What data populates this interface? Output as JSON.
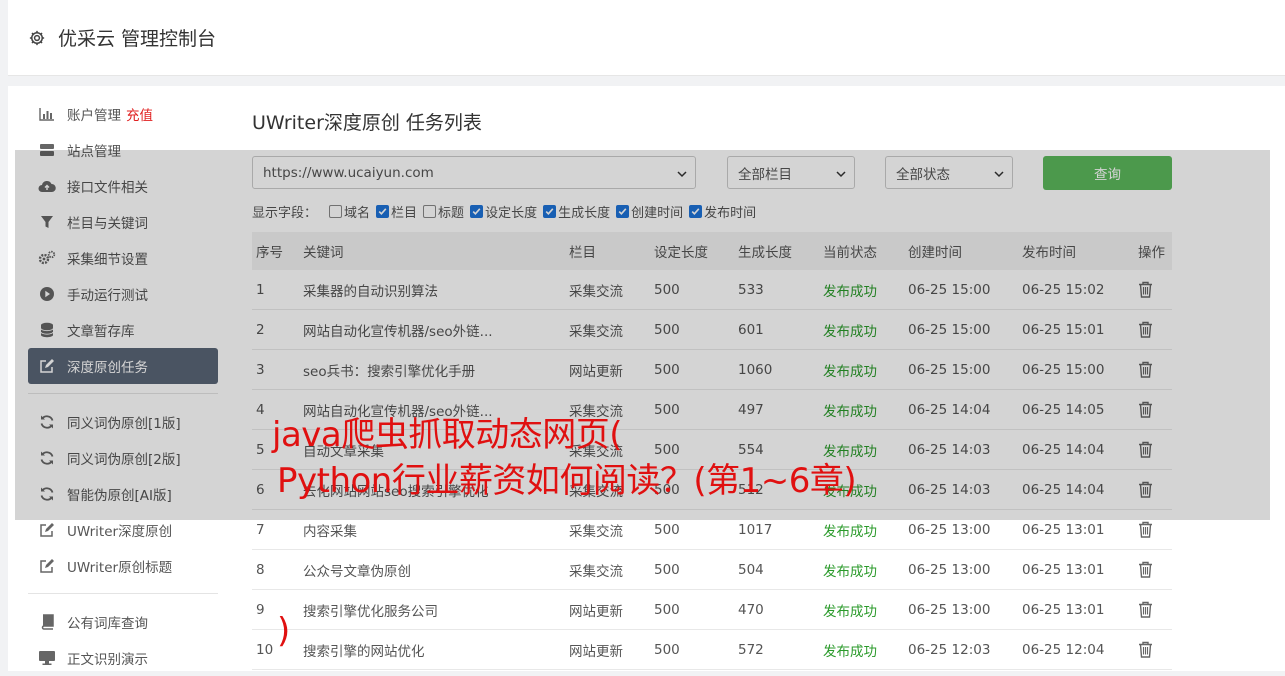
{
  "header": {
    "title": "优采云 管理控制台",
    "icon": "gear-icon"
  },
  "sidebar": {
    "group1": [
      {
        "label": "账户管理",
        "badge": "充值",
        "icon": "bar-chart-icon"
      },
      {
        "label": "站点管理",
        "icon": "server-icon"
      },
      {
        "label": "接口文件相关",
        "icon": "cloud-upload-icon"
      },
      {
        "label": "栏目与关键词",
        "icon": "filter-icon"
      },
      {
        "label": "采集细节设置",
        "icon": "cogs-icon"
      },
      {
        "label": "手动运行测试",
        "icon": "play-circle-icon"
      },
      {
        "label": "文章暂存库",
        "icon": "database-icon"
      },
      {
        "label": "深度原创任务",
        "icon": "edit-icon",
        "active": true
      }
    ],
    "group2": [
      {
        "label": "同义词伪原创[1版]",
        "icon": "refresh-icon"
      },
      {
        "label": "同义词伪原创[2版]",
        "icon": "refresh-icon"
      },
      {
        "label": "智能伪原创[AI版]",
        "icon": "refresh-icon"
      },
      {
        "label": "UWriter深度原创",
        "icon": "edit-icon"
      },
      {
        "label": "UWriter原创标题",
        "icon": "edit-icon"
      }
    ],
    "group3": [
      {
        "label": "公有词库查询",
        "icon": "book-icon"
      },
      {
        "label": "正文识别演示",
        "icon": "desktop-icon"
      }
    ]
  },
  "main": {
    "title": "UWriter深度原创 任务列表",
    "site_select": "https://www.ucaiyun.com",
    "column_select": "全部栏目",
    "status_select": "全部状态",
    "query_label": "查询",
    "fields_label": "显示字段：",
    "fields": [
      {
        "label": "域名",
        "checked": false
      },
      {
        "label": "栏目",
        "checked": true
      },
      {
        "label": "标题",
        "checked": false
      },
      {
        "label": "设定长度",
        "checked": true
      },
      {
        "label": "生成长度",
        "checked": true
      },
      {
        "label": "创建时间",
        "checked": true
      },
      {
        "label": "发布时间",
        "checked": true
      }
    ],
    "columns": [
      "序号",
      "关键词",
      "栏目",
      "设定长度",
      "生成长度",
      "当前状态",
      "创建时间",
      "发布时间",
      "操作"
    ],
    "rows": [
      [
        "1",
        "采集器的自动识别算法",
        "采集交流",
        "500",
        "533",
        "发布成功",
        "06-25 15:00",
        "06-25 15:02"
      ],
      [
        "2",
        "网站自动化宣传机器/seo外链...",
        "采集交流",
        "500",
        "601",
        "发布成功",
        "06-25 15:00",
        "06-25 15:01"
      ],
      [
        "3",
        "seo兵书：搜索引擎优化手册",
        "网站更新",
        "500",
        "1060",
        "发布成功",
        "06-25 15:00",
        "06-25 15:00"
      ],
      [
        "4",
        "网站自动化宣传机器/seo外链...",
        "采集交流",
        "500",
        "497",
        "发布成功",
        "06-25 14:04",
        "06-25 14:05"
      ],
      [
        "5",
        "自动文章采集",
        "采集交流",
        "500",
        "554",
        "发布成功",
        "06-25 14:03",
        "06-25 14:04"
      ],
      [
        "6",
        "去化网站网站seo搜索引擎优化",
        "采集交流",
        "500",
        "512",
        "发布成功",
        "06-25 14:03",
        "06-25 14:04"
      ],
      [
        "7",
        "内容采集",
        "采集交流",
        "500",
        "1017",
        "发布成功",
        "06-25 13:00",
        "06-25 13:01"
      ],
      [
        "8",
        "公众号文章伪原创",
        "采集交流",
        "500",
        "504",
        "发布成功",
        "06-25 13:00",
        "06-25 13:01"
      ],
      [
        "9",
        "搜索引擎优化服务公司",
        "网站更新",
        "500",
        "470",
        "发布成功",
        "06-25 13:00",
        "06-25 13:01"
      ],
      [
        "10",
        "搜索引擎的网站优化",
        "网站更新",
        "500",
        "572",
        "发布成功",
        "06-25 12:03",
        "06-25 12:04"
      ]
    ]
  },
  "banner": {
    "line1": "java爬虫抓取动态网页(",
    "line2": "Python行业薪资如何阅读？(第1~6章)",
    "line3": ")"
  },
  "colors": {
    "accent": "#5cb85c",
    "active_bg": "#5a6576",
    "success": "#2a9a2a",
    "banner": "#e01010"
  }
}
